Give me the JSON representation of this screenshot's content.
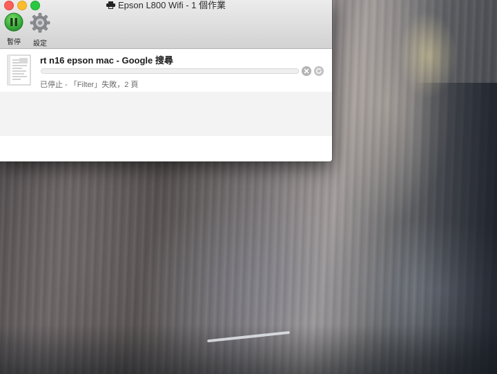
{
  "window": {
    "title": "Epson L800 Wifi - 1 個作業",
    "title_icon": "printer-icon"
  },
  "toolbar": {
    "pause_label": "暫停",
    "pause_icon": "pause-icon",
    "settings_label": "設定",
    "settings_icon": "gear-icon"
  },
  "jobs": [
    {
      "name": "rt n16 epson mac - Google 搜尋",
      "status": "已停止 - 「Filter」失敗，2 頁",
      "progress": 0,
      "icon": "document-icon"
    }
  ],
  "colors": {
    "close": "#fc5f57",
    "minimize": "#fdbc2e",
    "maximize": "#29c840",
    "pause_green": "#34a63a"
  }
}
